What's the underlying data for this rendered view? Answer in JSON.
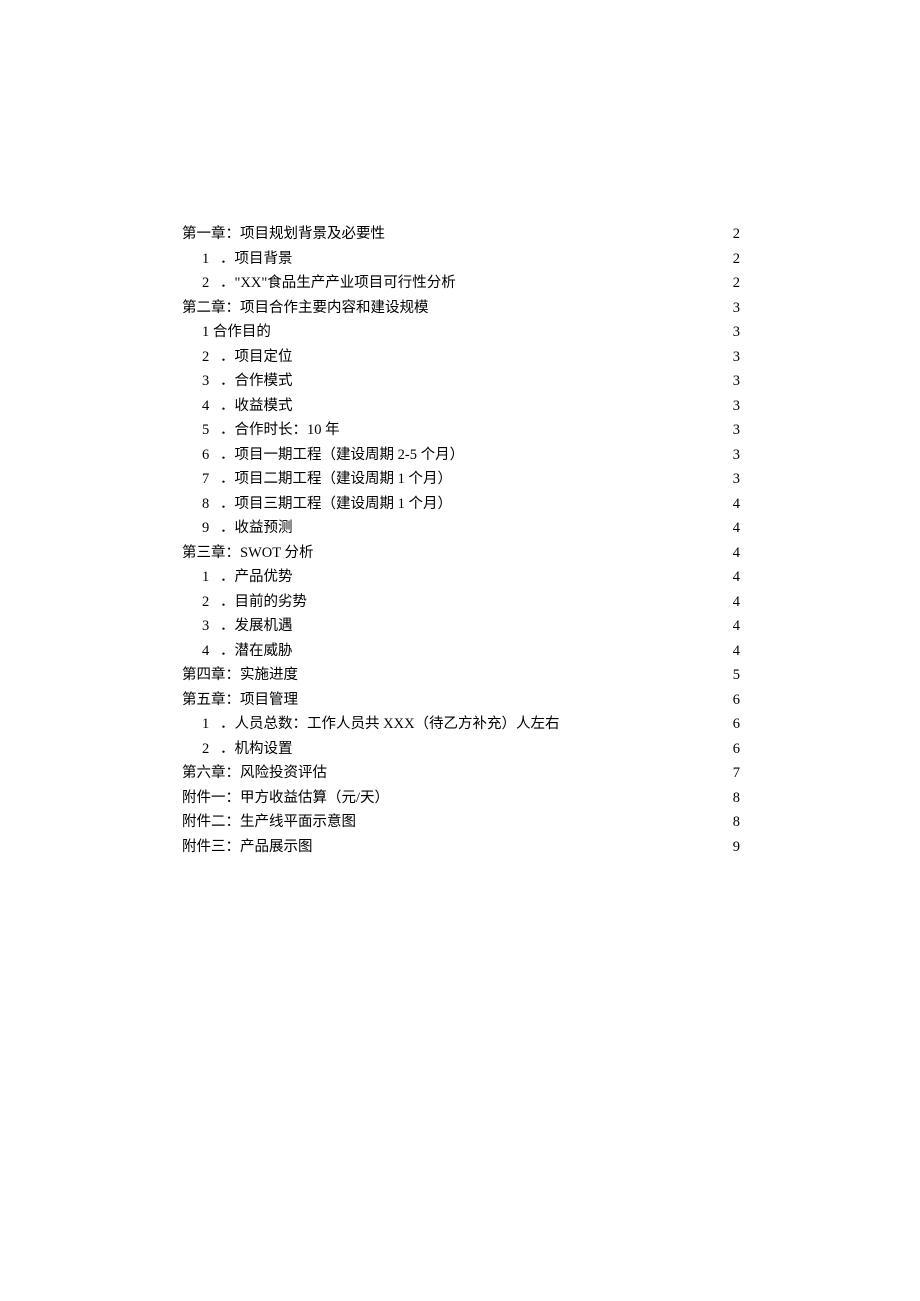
{
  "toc": [
    {
      "level": 0,
      "num": "",
      "title": "第一章：项目规划背景及必要性",
      "page": "2"
    },
    {
      "level": 1,
      "num": "1",
      "title": "．项目背景",
      "page": "2"
    },
    {
      "level": 1,
      "num": "2",
      "title": "．\"XX\"食品生产产业项目可行性分析",
      "page": "2"
    },
    {
      "level": 0,
      "num": "",
      "title": "第二章：项目合作主要内容和建设规模",
      "page": "3"
    },
    {
      "level": 1,
      "num": "",
      "title": "1 合作目的",
      "page": "3"
    },
    {
      "level": 1,
      "num": "2",
      "title": "．项目定位",
      "page": "3"
    },
    {
      "level": 1,
      "num": "3",
      "title": "．合作模式",
      "page": "3"
    },
    {
      "level": 1,
      "num": "4",
      "title": "．收益模式",
      "page": "3"
    },
    {
      "level": 1,
      "num": "5",
      "title": "．合作时长：10 年",
      "page": "3"
    },
    {
      "level": 1,
      "num": "6",
      "title": "．项目一期工程（建设周期 2-5 个月）",
      "page": "3"
    },
    {
      "level": 1,
      "num": "7",
      "title": "．项目二期工程（建设周期 1 个月）",
      "page": "3"
    },
    {
      "level": 1,
      "num": "8",
      "title": "．项目三期工程（建设周期 1 个月）",
      "page": "4"
    },
    {
      "level": 1,
      "num": "9",
      "title": "．收益预测",
      "page": "4"
    },
    {
      "level": 0,
      "num": "",
      "title": "第三章：SWOT 分析",
      "page": "4"
    },
    {
      "level": 1,
      "num": "1",
      "title": "．产品优势",
      "page": "4"
    },
    {
      "level": 1,
      "num": "2",
      "title": "．目前的劣势",
      "page": "4"
    },
    {
      "level": 1,
      "num": "3",
      "title": "．发展机遇",
      "page": "4"
    },
    {
      "level": 1,
      "num": "4",
      "title": "．潜在威胁",
      "page": "4"
    },
    {
      "level": 0,
      "num": "",
      "title": "第四章：实施进度",
      "page": "5"
    },
    {
      "level": 0,
      "num": "",
      "title": "第五章：项目管理",
      "page": "6"
    },
    {
      "level": 1,
      "num": "1",
      "title": "．人员总数：工作人员共 XXX（待乙方补充）人左右",
      "page": "6"
    },
    {
      "level": 1,
      "num": "2",
      "title": "．机构设置",
      "page": "6"
    },
    {
      "level": 0,
      "num": "",
      "title": "第六章：风险投资评估",
      "page": "7"
    },
    {
      "level": 0,
      "num": "",
      "title": "附件一：甲方收益估算（元/天）",
      "page": "8"
    },
    {
      "level": 0,
      "num": "",
      "title": "附件二：生产线平面示意图",
      "page": "8"
    },
    {
      "level": 0,
      "num": "",
      "title": "附件三：产品展示图",
      "page": "9"
    }
  ]
}
